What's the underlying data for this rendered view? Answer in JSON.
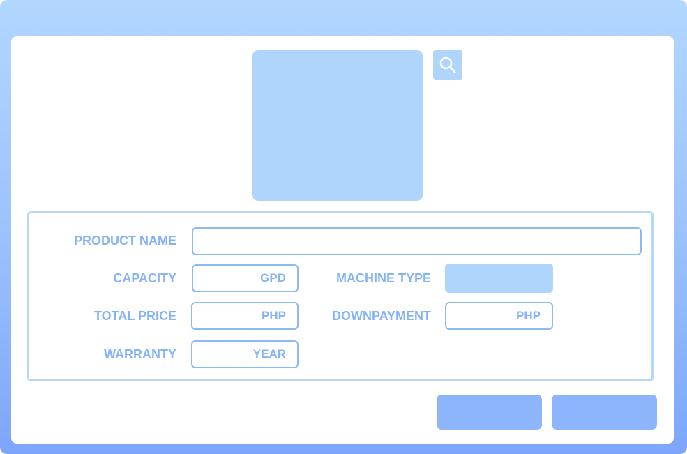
{
  "form": {
    "product_name_label": "PRODUCT NAME",
    "product_name_value": "",
    "capacity_label": "CAPACITY",
    "capacity_unit": "GPD",
    "machine_type_label": "MACHINE TYPE",
    "machine_type_value": "",
    "total_price_label": "TOTAL PRICE",
    "total_price_unit": "PHP",
    "downpayment_label": "DOWNPAYMENT",
    "downpayment_unit": "PHP",
    "warranty_label": "WARRANTY",
    "warranty_unit": "YEAR"
  },
  "icons": {
    "search": "search-icon"
  },
  "colors": {
    "accent": "#85b3f7",
    "placeholder_fill": "#b0d5fd",
    "button_fill": "#8db5fb",
    "field_border": "#8db9f6"
  }
}
